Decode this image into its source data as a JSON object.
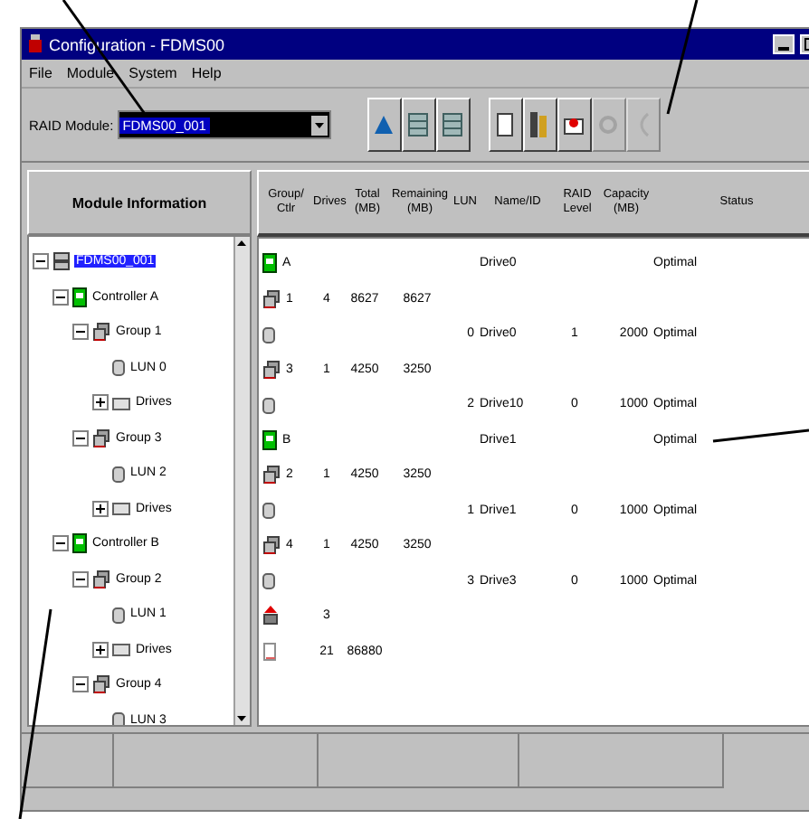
{
  "window": {
    "title": "Configuration - FDMS00"
  },
  "menu": [
    "File",
    "Module",
    "System",
    "Help"
  ],
  "toolbar": {
    "module_label": "RAID Module:",
    "module_value": "FDMS00_001",
    "buttons": [
      {
        "kind": "disk",
        "disabled": false
      },
      {
        "kind": "grid",
        "disabled": false
      },
      {
        "kind": "grid",
        "disabled": false
      },
      {
        "kind": "page",
        "disabled": false
      },
      {
        "kind": "bars",
        "disabled": false
      },
      {
        "kind": "drive",
        "disabled": false
      },
      {
        "kind": "gear",
        "disabled": true
      },
      {
        "kind": "arc",
        "disabled": true
      }
    ]
  },
  "tree": {
    "heading": "Module Information",
    "items": [
      {
        "label": "FDMS00_001",
        "kind": "module",
        "expanded": true,
        "selected": true,
        "children": [
          {
            "label": "Controller A",
            "kind": "controller",
            "expanded": true,
            "selected": false,
            "children": [
              {
                "label": "Group 1",
                "kind": "group",
                "expanded": true,
                "selected": false,
                "children": [
                  {
                    "label": "LUN 0",
                    "kind": "lun",
                    "selected": false
                  },
                  {
                    "label": "Drives",
                    "kind": "drives",
                    "expanded": false,
                    "selected": false
                  }
                ]
              },
              {
                "label": "Group 3",
                "kind": "group",
                "expanded": true,
                "selected": false,
                "children": [
                  {
                    "label": "LUN 2",
                    "kind": "lun",
                    "selected": false
                  },
                  {
                    "label": "Drives",
                    "kind": "drives",
                    "expanded": false,
                    "selected": false
                  }
                ]
              }
            ]
          },
          {
            "label": "Controller B",
            "kind": "controller",
            "expanded": true,
            "selected": false,
            "children": [
              {
                "label": "Group 2",
                "kind": "group",
                "expanded": true,
                "selected": false,
                "children": [
                  {
                    "label": "LUN 1",
                    "kind": "lun",
                    "selected": false
                  },
                  {
                    "label": "Drives",
                    "kind": "drives",
                    "expanded": false,
                    "selected": false
                  }
                ]
              },
              {
                "label": "Group 4",
                "kind": "group",
                "expanded": true,
                "selected": false,
                "children": [
                  {
                    "label": "LUN 3",
                    "kind": "lun",
                    "selected": false
                  }
                ]
              }
            ]
          }
        ]
      }
    ]
  },
  "table": {
    "columns": [
      "Group/ Ctlr",
      "Drives",
      "Total (MB)",
      "Remaining (MB)",
      "LUN",
      "Name/ID",
      "RAID Level",
      "Capacity (MB)",
      "Status"
    ],
    "rows": [
      {
        "kind": "controller",
        "group": "A",
        "name": "Drive0",
        "status": "Optimal"
      },
      {
        "kind": "group",
        "group": "1",
        "drives": "4",
        "total": "8627",
        "remaining": "8627"
      },
      {
        "kind": "lun",
        "lun": "0",
        "name": "Drive0",
        "raid_level": "1",
        "capacity": "2000",
        "status": "Optimal"
      },
      {
        "kind": "group",
        "group": "3",
        "drives": "1",
        "total": "4250",
        "remaining": "3250"
      },
      {
        "kind": "lun",
        "lun": "2",
        "name": "Drive10",
        "raid_level": "0",
        "capacity": "1000",
        "status": "Optimal"
      },
      {
        "kind": "controller",
        "group": "B",
        "name": "Drive1",
        "status": "Optimal"
      },
      {
        "kind": "group",
        "group": "2",
        "drives": "1",
        "total": "4250",
        "remaining": "3250"
      },
      {
        "kind": "lun",
        "lun": "1",
        "name": "Drive1",
        "raid_level": "0",
        "capacity": "1000",
        "status": "Optimal"
      },
      {
        "kind": "group",
        "group": "4",
        "drives": "1",
        "total": "4250",
        "remaining": "3250"
      },
      {
        "kind": "lun",
        "lun": "3",
        "name": "Drive3",
        "raid_level": "0",
        "capacity": "1000",
        "status": "Optimal"
      },
      {
        "kind": "spare",
        "drives": "3"
      },
      {
        "kind": "unassigned",
        "drives": "21",
        "total": "86880"
      }
    ]
  }
}
